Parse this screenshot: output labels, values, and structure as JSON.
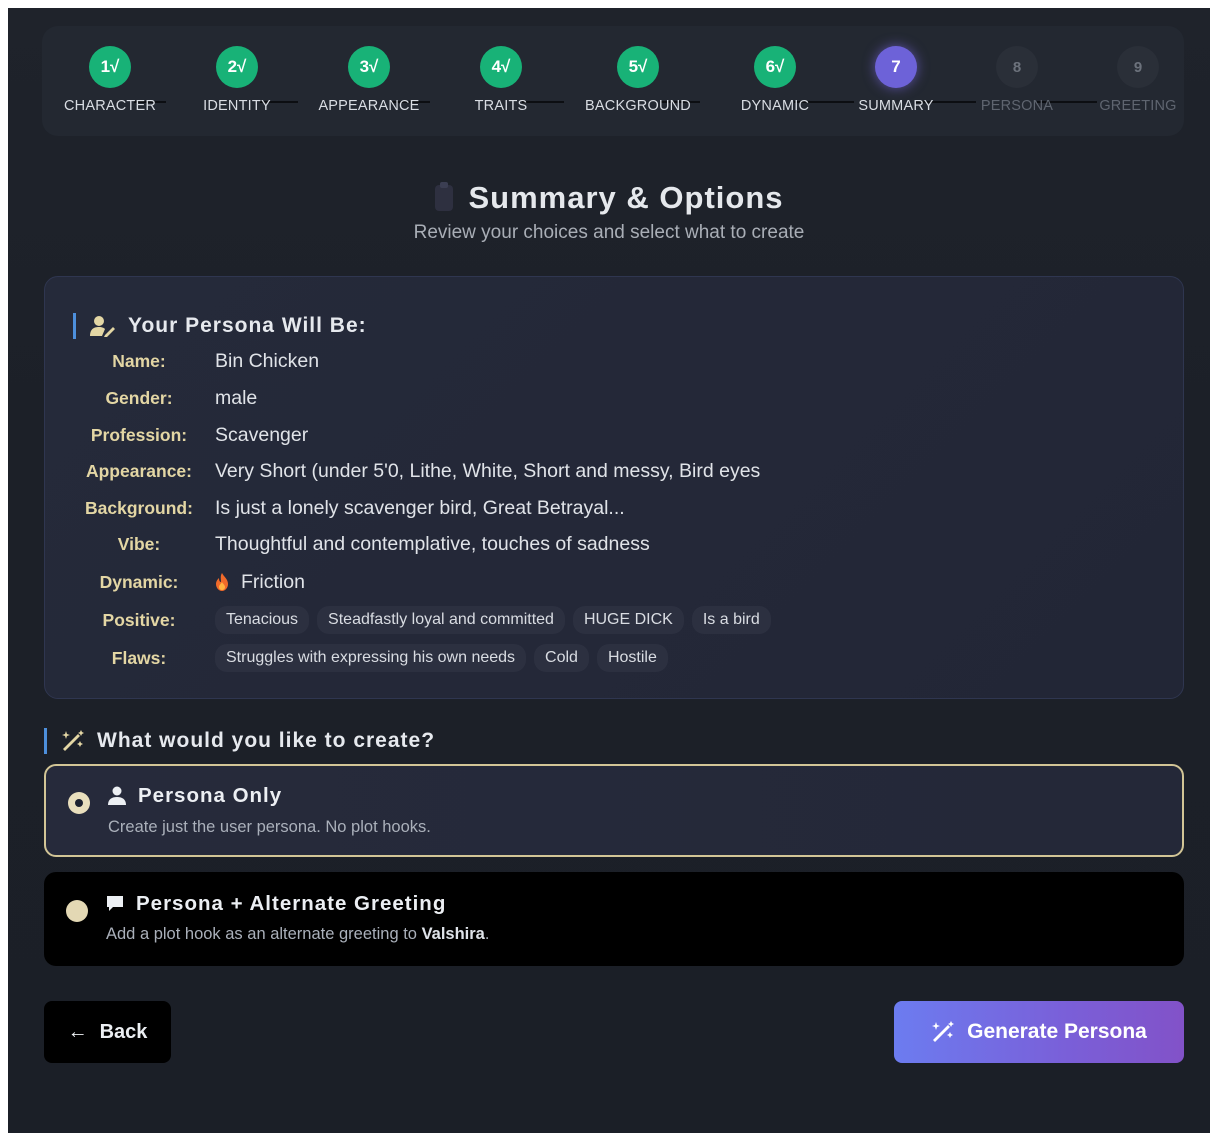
{
  "stepper": {
    "steps": [
      {
        "number": "1√",
        "label": "CHARACTER",
        "state": "done"
      },
      {
        "number": "2√",
        "label": "IDENTITY",
        "state": "done"
      },
      {
        "number": "3√",
        "label": "APPEARANCE",
        "state": "done"
      },
      {
        "number": "4√",
        "label": "TRAITS",
        "state": "done"
      },
      {
        "number": "5√",
        "label": "BACKGROUND",
        "state": "done"
      },
      {
        "number": "6√",
        "label": "DYNAMIC",
        "state": "done"
      },
      {
        "number": "7",
        "label": "SUMMARY",
        "state": "active"
      },
      {
        "number": "8",
        "label": "PERSONA",
        "state": "pending"
      },
      {
        "number": "9",
        "label": "GREETING",
        "state": "pending"
      }
    ]
  },
  "header": {
    "icon": "clipboard-icon",
    "title": "Summary & Options",
    "subtitle": "Review your choices and select what to create"
  },
  "persona_summary": {
    "icon": "user-edit-icon",
    "title": "Your Persona Will Be:",
    "name_label": "Name:",
    "name": "Bin Chicken",
    "gender_label": "Gender:",
    "gender": "male",
    "profession_label": "Profession:",
    "profession": "Scavenger",
    "appearance_label": "Appearance:",
    "appearance": "Very Short (under 5'0, Lithe, White, Short and messy, Bird eyes",
    "background_label": "Background:",
    "background": "Is just a lonely scavenger bird, Great Betrayal...",
    "vibe_label": "Vibe:",
    "vibe": "Thoughtful and contemplative, touches of sadness",
    "dynamic_label": "Dynamic:",
    "dynamic_icon": "fire-icon",
    "dynamic": "Friction",
    "positive_label": "Positive:",
    "positive": [
      "Tenacious",
      "Steadfastly loyal and committed",
      "HUGE DICK",
      "Is a bird"
    ],
    "flaws_label": "Flaws:",
    "flaws": [
      "Struggles with expressing his own needs",
      "Cold",
      "Hostile"
    ]
  },
  "create": {
    "icon": "magic-wand-icon",
    "title": "What would you like to create?",
    "options": [
      {
        "icon": "user-icon",
        "title": "Persona Only",
        "desc": "Create just the user persona. No plot hooks.",
        "selected": true
      },
      {
        "icon": "chat-bubble-icon",
        "title": "Persona + Alternate Greeting",
        "desc_prefix": "Add a plot hook as an alternate greeting to ",
        "desc_bold": "Valshira",
        "desc_suffix": ".",
        "selected": false
      }
    ]
  },
  "actions": {
    "back_label": "Back",
    "generate_label": "Generate Persona"
  },
  "colors": {
    "done": "#18b277",
    "active": "#6d62d8",
    "accent_bar": "#4d8fdc",
    "label_gold": "#e3d6a4",
    "selected_border": "#d2c596"
  }
}
